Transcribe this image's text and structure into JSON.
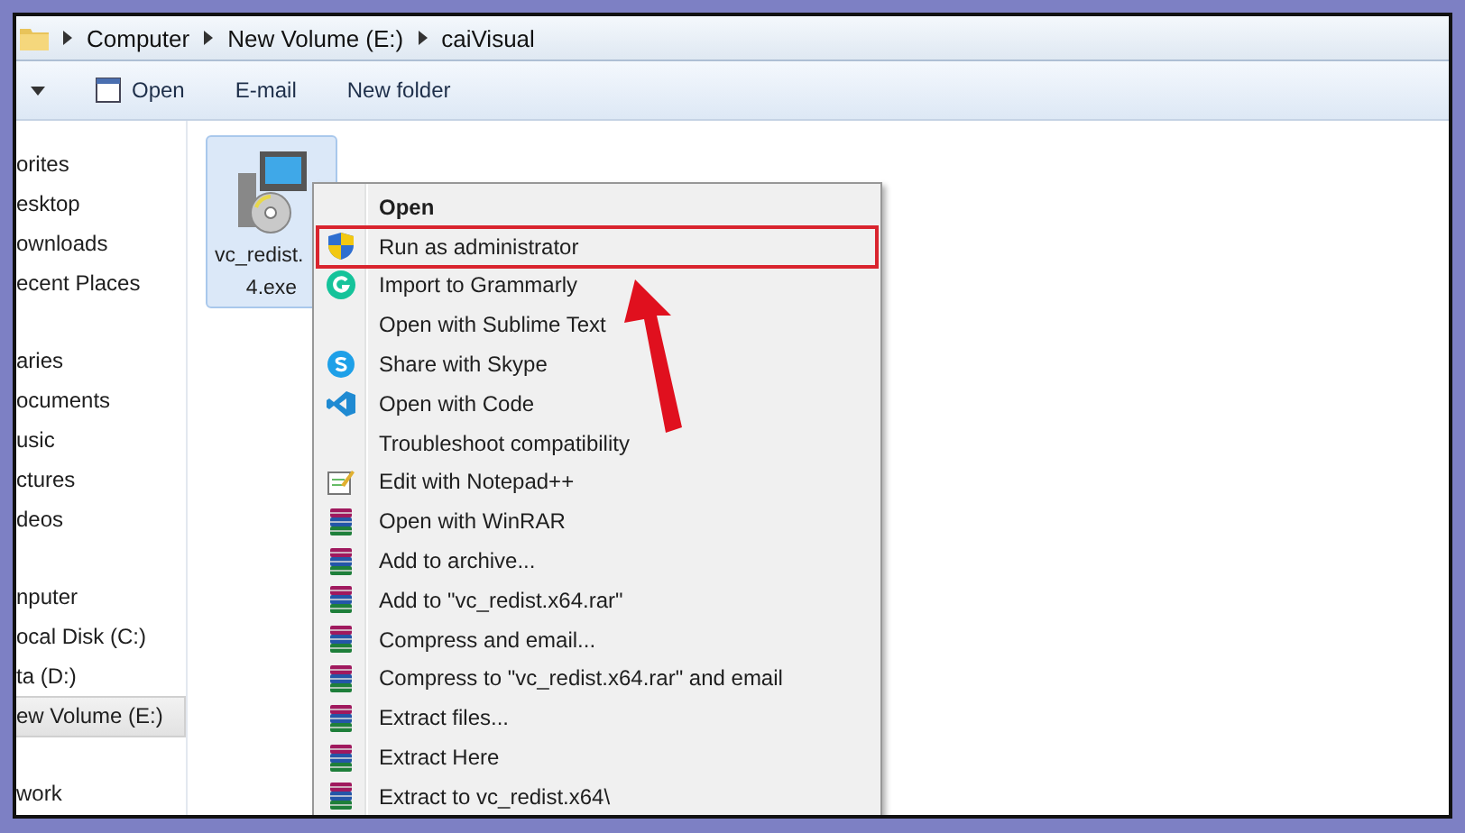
{
  "address_bar": {
    "crumbs": [
      "Computer",
      "New Volume (E:)",
      "caiVisual"
    ]
  },
  "toolbar": {
    "buttons": [
      {
        "label": "Open",
        "kind": "open"
      },
      {
        "label": "E-mail",
        "kind": "plain"
      },
      {
        "label": "New folder",
        "kind": "plain"
      }
    ]
  },
  "sidebar": {
    "groups": [
      {
        "items": [
          {
            "label": "orites",
            "selected": false
          },
          {
            "label": "esktop",
            "selected": false
          },
          {
            "label": "ownloads",
            "selected": false
          },
          {
            "label": "ecent Places",
            "selected": false
          }
        ]
      },
      {
        "items": [
          {
            "label": "aries",
            "selected": false
          },
          {
            "label": "ocuments",
            "selected": false
          },
          {
            "label": "usic",
            "selected": false
          },
          {
            "label": "ctures",
            "selected": false
          },
          {
            "label": "deos",
            "selected": false
          }
        ]
      },
      {
        "items": [
          {
            "label": "nputer",
            "selected": false
          },
          {
            "label": "ocal Disk (C:)",
            "selected": false
          },
          {
            "label": "ta (D:)",
            "selected": false
          },
          {
            "label": "ew Volume (E:)",
            "selected": true
          }
        ]
      },
      {
        "items": [
          {
            "label": "work",
            "selected": false
          }
        ]
      }
    ]
  },
  "file": {
    "lines": [
      "vc_redist.",
      "4.exe"
    ],
    "selected": true
  },
  "context_menu": {
    "items": [
      {
        "label": "Open",
        "kind": "none",
        "bold": true,
        "highlighted": false
      },
      {
        "label": "Run as administrator",
        "kind": "shield",
        "bold": false,
        "highlighted": true
      },
      {
        "label": "Import to Grammarly",
        "kind": "grammarly",
        "bold": false,
        "highlighted": false
      },
      {
        "label": "Open with Sublime Text",
        "kind": "none",
        "bold": false,
        "highlighted": false
      },
      {
        "label": "Share with Skype",
        "kind": "skype",
        "bold": false,
        "highlighted": false
      },
      {
        "label": "Open with Code",
        "kind": "vscode",
        "bold": false,
        "highlighted": false
      },
      {
        "label": "Troubleshoot compatibility",
        "kind": "none",
        "bold": false,
        "highlighted": false
      },
      {
        "label": "Edit with Notepad++",
        "kind": "notepad",
        "bold": false,
        "highlighted": false
      },
      {
        "label": "Open with WinRAR",
        "kind": "winrar",
        "bold": false,
        "highlighted": false
      },
      {
        "label": "Add to archive...",
        "kind": "winrar",
        "bold": false,
        "highlighted": false
      },
      {
        "label": "Add to \"vc_redist.x64.rar\"",
        "kind": "winrar",
        "bold": false,
        "highlighted": false
      },
      {
        "label": "Compress and email...",
        "kind": "winrar",
        "bold": false,
        "highlighted": false
      },
      {
        "label": "Compress to \"vc_redist.x64.rar\" and email",
        "kind": "winrar",
        "bold": false,
        "highlighted": false
      },
      {
        "label": "Extract files...",
        "kind": "winrar",
        "bold": false,
        "highlighted": false
      },
      {
        "label": "Extract Here",
        "kind": "winrar",
        "bold": false,
        "highlighted": false
      },
      {
        "label": "Extract to vc_redist.x64\\",
        "kind": "winrar",
        "bold": false,
        "highlighted": false
      }
    ]
  }
}
